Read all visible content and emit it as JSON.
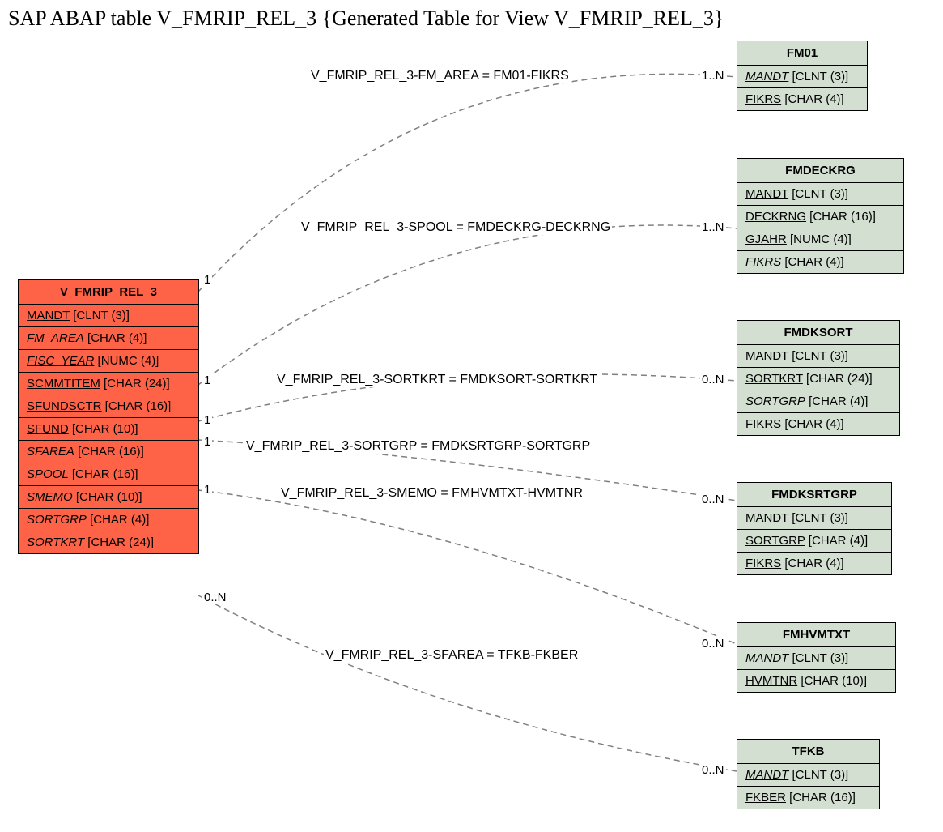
{
  "title": "SAP ABAP table V_FMRIP_REL_3 {Generated Table for View V_FMRIP_REL_3}",
  "main": {
    "name": "V_FMRIP_REL_3",
    "fields": [
      {
        "name": "MANDT",
        "type": "[CLNT (3)]",
        "underline": true,
        "italic": false
      },
      {
        "name": "FM_AREA",
        "type": "[CHAR (4)]",
        "underline": true,
        "italic": true
      },
      {
        "name": "FISC_YEAR",
        "type": "[NUMC (4)]",
        "underline": true,
        "italic": true
      },
      {
        "name": "SCMMTITEM",
        "type": "[CHAR (24)]",
        "underline": true,
        "italic": false
      },
      {
        "name": "SFUNDSCTR",
        "type": "[CHAR (16)]",
        "underline": true,
        "italic": false
      },
      {
        "name": "SFUND",
        "type": "[CHAR (10)]",
        "underline": true,
        "italic": false
      },
      {
        "name": "SFAREA",
        "type": "[CHAR (16)]",
        "underline": false,
        "italic": true
      },
      {
        "name": "SPOOL",
        "type": "[CHAR (16)]",
        "underline": false,
        "italic": true
      },
      {
        "name": "SMEMO",
        "type": "[CHAR (10)]",
        "underline": false,
        "italic": true
      },
      {
        "name": "SORTGRP",
        "type": "[CHAR (4)]",
        "underline": false,
        "italic": true
      },
      {
        "name": "SORTKRT",
        "type": "[CHAR (24)]",
        "underline": false,
        "italic": true
      }
    ]
  },
  "related": [
    {
      "name": "FM01",
      "fields": [
        {
          "name": "MANDT",
          "type": "[CLNT (3)]",
          "underline": true,
          "italic": true
        },
        {
          "name": "FIKRS",
          "type": "[CHAR (4)]",
          "underline": true,
          "italic": false
        }
      ]
    },
    {
      "name": "FMDECKRG",
      "fields": [
        {
          "name": "MANDT",
          "type": "[CLNT (3)]",
          "underline": true,
          "italic": false
        },
        {
          "name": "DECKRNG",
          "type": "[CHAR (16)]",
          "underline": true,
          "italic": false
        },
        {
          "name": "GJAHR",
          "type": "[NUMC (4)]",
          "underline": true,
          "italic": false
        },
        {
          "name": "FIKRS",
          "type": "[CHAR (4)]",
          "underline": false,
          "italic": true
        }
      ]
    },
    {
      "name": "FMDKSORT",
      "fields": [
        {
          "name": "MANDT",
          "type": "[CLNT (3)]",
          "underline": true,
          "italic": false
        },
        {
          "name": "SORTKRT",
          "type": "[CHAR (24)]",
          "underline": true,
          "italic": false
        },
        {
          "name": "SORTGRP",
          "type": "[CHAR (4)]",
          "underline": false,
          "italic": true
        },
        {
          "name": "FIKRS",
          "type": "[CHAR (4)]",
          "underline": true,
          "italic": false
        }
      ]
    },
    {
      "name": "FMDKSRTGRP",
      "fields": [
        {
          "name": "MANDT",
          "type": "[CLNT (3)]",
          "underline": true,
          "italic": false
        },
        {
          "name": "SORTGRP",
          "type": "[CHAR (4)]",
          "underline": true,
          "italic": false
        },
        {
          "name": "FIKRS",
          "type": "[CHAR (4)]",
          "underline": true,
          "italic": false
        }
      ]
    },
    {
      "name": "FMHVMTXT",
      "fields": [
        {
          "name": "MANDT",
          "type": "[CLNT (3)]",
          "underline": true,
          "italic": true
        },
        {
          "name": "HVMTNR",
          "type": "[CHAR (10)]",
          "underline": true,
          "italic": false
        }
      ]
    },
    {
      "name": "TFKB",
      "fields": [
        {
          "name": "MANDT",
          "type": "[CLNT (3)]",
          "underline": true,
          "italic": true
        },
        {
          "name": "FKBER",
          "type": "[CHAR (16)]",
          "underline": true,
          "italic": false
        }
      ]
    }
  ],
  "relations": [
    {
      "label": "V_FMRIP_REL_3-FM_AREA = FM01-FIKRS",
      "left_card": "1",
      "right_card": "1..N"
    },
    {
      "label": "V_FMRIP_REL_3-SPOOL = FMDECKRG-DECKRNG",
      "left_card": "1",
      "right_card": "1..N"
    },
    {
      "label": "V_FMRIP_REL_3-SORTKRT = FMDKSORT-SORTKRT",
      "left_card": "1",
      "right_card": "0..N"
    },
    {
      "label": "V_FMRIP_REL_3-SORTGRP = FMDKSRTGRP-SORTGRP",
      "left_card": "1",
      "right_card": "0..N"
    },
    {
      "label": "V_FMRIP_REL_3-SMEMO = FMHVMTXT-HVMTNR",
      "left_card": "1",
      "right_card": "0..N"
    },
    {
      "label": "V_FMRIP_REL_3-SFAREA = TFKB-FKBER",
      "left_card": "0..N",
      "right_card": "0..N"
    }
  ]
}
